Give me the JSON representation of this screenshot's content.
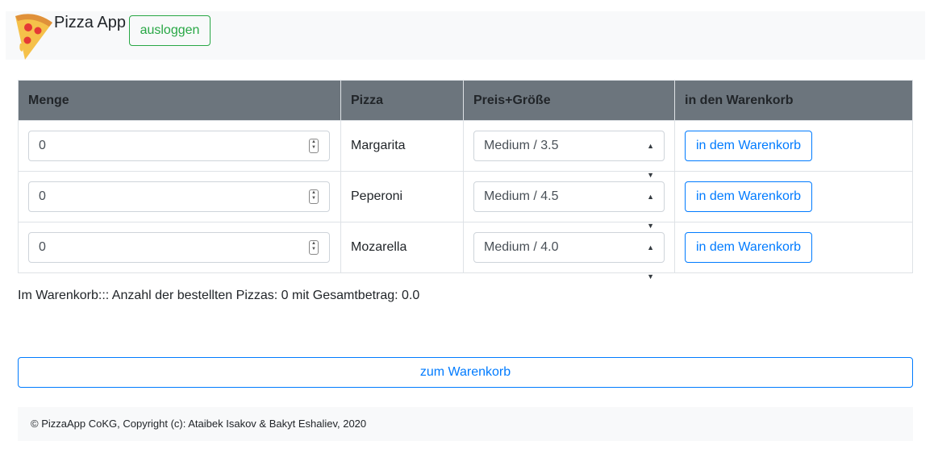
{
  "navbar": {
    "brand": "Pizza App",
    "logout_label": "ausloggen",
    "logo_icon": "pizza-slice-icon"
  },
  "table": {
    "headers": [
      "Menge",
      "Pizza",
      "Preis+Größe",
      "in den Warenkorb"
    ],
    "rows": [
      {
        "quantity": "0",
        "name": "Margarita",
        "size_price": "Medium / 3.5",
        "button": "in dem Warenkorb"
      },
      {
        "quantity": "0",
        "name": "Peperoni",
        "size_price": "Medium / 4.5",
        "button": "in dem Warenkorb"
      },
      {
        "quantity": "0",
        "name": "Mozarella",
        "size_price": "Medium / 4.0",
        "button": "in dem Warenkorb"
      }
    ]
  },
  "summary": "Im Warenkorb::: Anzahl der bestellten Pizzas: 0 mit Gesamtbetrag: 0.0",
  "to_cart_label": "zum Warenkorb",
  "footer": "© PizzaApp CoKG, Copyright (c): Ataibek Isakov & Bakyt Eshaliev, 2020",
  "colors": {
    "success": "#28a745",
    "primary": "#007bff",
    "header_bg": "#6c757d",
    "light_bg": "#f8f9fa"
  }
}
